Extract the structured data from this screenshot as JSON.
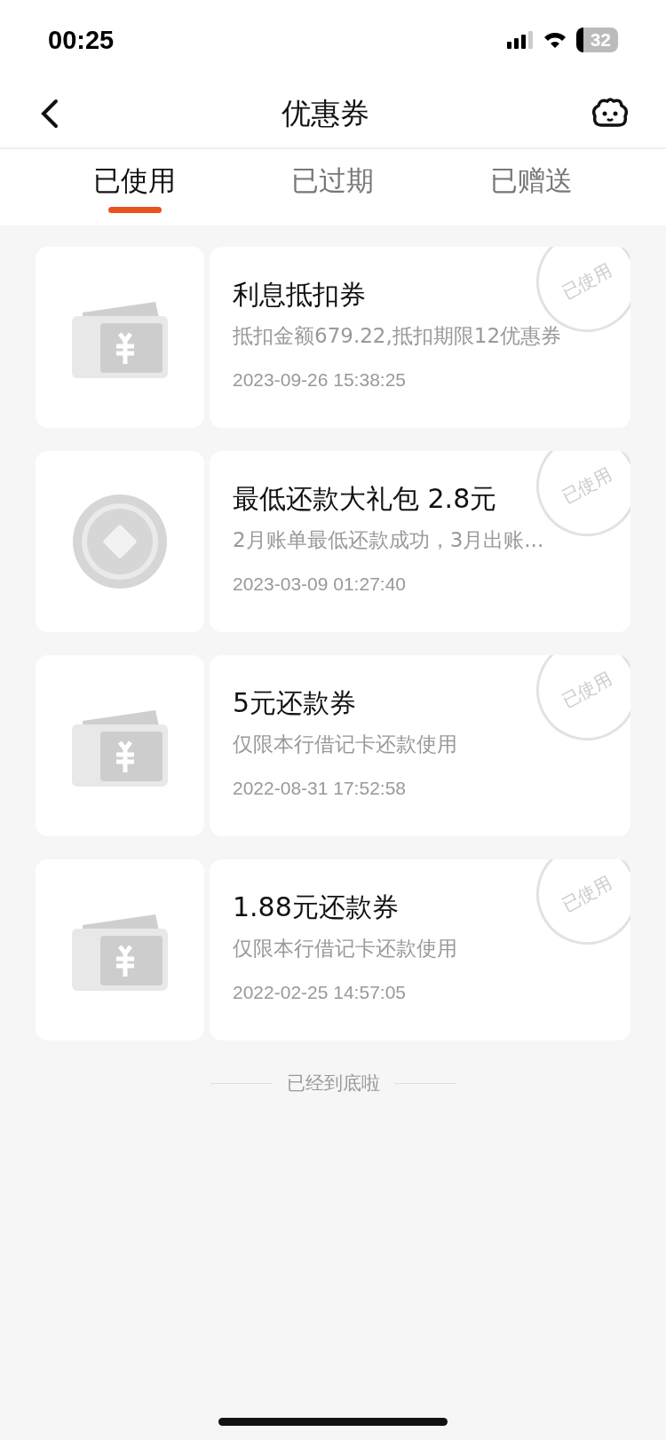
{
  "status_bar": {
    "time": "00:25",
    "battery": "32"
  },
  "nav": {
    "title": "优惠券"
  },
  "tabs": [
    {
      "label": "已使用",
      "selected": true
    },
    {
      "label": "已过期",
      "selected": false
    },
    {
      "label": "已赠送",
      "selected": false
    }
  ],
  "coupons": [
    {
      "kind": "ticket",
      "title": "利息抵扣券",
      "description": "抵扣金额679.22,抵扣期限12优惠券",
      "date": "2023-09-26 15:38:25",
      "stamp": "已使用"
    },
    {
      "kind": "coin",
      "title": "最低还款大礼包 2.8元",
      "description": "2月账单最低还款成功，3月出账...",
      "date": "2023-03-09 01:27:40",
      "stamp": "已使用"
    },
    {
      "kind": "ticket",
      "title": "5元还款券",
      "description": "仅限本行借记卡还款使用",
      "date": "2022-08-31 17:52:58",
      "stamp": "已使用"
    },
    {
      "kind": "ticket",
      "title": "1.88元还款券",
      "description": "仅限本行借记卡还款使用",
      "date": "2022-02-25 14:57:05",
      "stamp": "已使用"
    }
  ],
  "footer": "已经到底啦"
}
